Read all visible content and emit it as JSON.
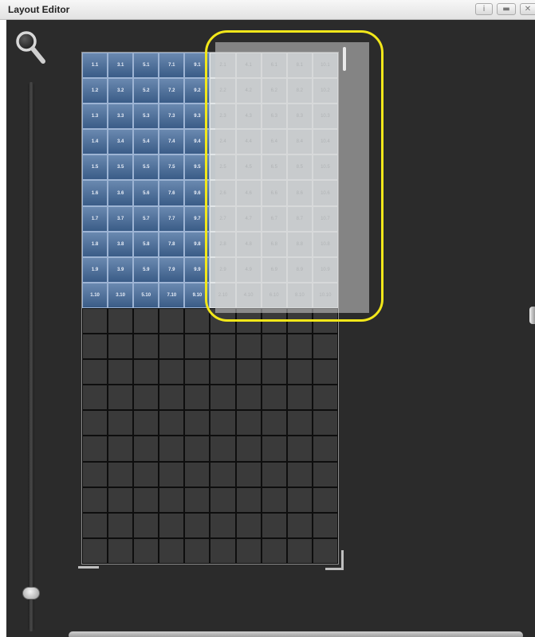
{
  "window": {
    "title": "Layout Editor",
    "buttons": [
      {
        "name": "info-button",
        "glyph": "i"
      },
      {
        "name": "keyboard-button",
        "glyph": "▬"
      },
      {
        "name": "close-button",
        "glyph": "✕"
      }
    ]
  },
  "editor": {
    "zoom_icon": "magnifier-icon",
    "zoom_level": 0.08,
    "grid": {
      "columns": 10,
      "rows": 20
    },
    "fixture_labels": [
      [
        "1.1",
        "3.1",
        "5.1",
        "7.1",
        "9.1",
        "2.1",
        "4.1",
        "6.1",
        "8.1",
        "10.1"
      ],
      [
        "1.2",
        "3.2",
        "5.2",
        "7.2",
        "9.2",
        "2.2",
        "4.2",
        "6.2",
        "8.2",
        "10.2"
      ],
      [
        "1.3",
        "3.3",
        "5.3",
        "7.3",
        "9.3",
        "2.3",
        "4.3",
        "6.3",
        "8.3",
        "10.3"
      ],
      [
        "1.4",
        "3.4",
        "5.4",
        "7.4",
        "9.4",
        "2.4",
        "4.4",
        "6.4",
        "8.4",
        "10.4"
      ],
      [
        "1.5",
        "3.5",
        "5.5",
        "7.5",
        "9.5",
        "2.5",
        "4.5",
        "6.5",
        "8.5",
        "10.5"
      ],
      [
        "1.6",
        "3.6",
        "5.6",
        "7.6",
        "9.6",
        "2.6",
        "4.6",
        "6.6",
        "8.6",
        "10.6"
      ],
      [
        "1.7",
        "3.7",
        "5.7",
        "7.7",
        "9.7",
        "2.7",
        "4.7",
        "6.7",
        "8.7",
        "10.7"
      ],
      [
        "1.8",
        "3.8",
        "5.8",
        "7.8",
        "9.8",
        "2.8",
        "4.8",
        "6.8",
        "8.8",
        "10.8"
      ],
      [
        "1.9",
        "3.9",
        "5.9",
        "7.9",
        "9.9",
        "2.9",
        "4.9",
        "6.9",
        "8.9",
        "10.9"
      ],
      [
        "1.10",
        "3.10",
        "5.10",
        "7.10",
        "9.10",
        "2.10",
        "4.10",
        "6.10",
        "8.10",
        "10.10"
      ]
    ],
    "placed_columns": 5,
    "highlight_color": "#f2e71a",
    "fixture_color": "#4d6f99"
  }
}
